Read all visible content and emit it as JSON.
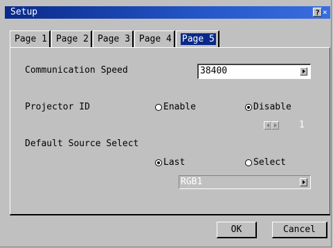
{
  "window": {
    "title": "Setup",
    "help_label": "?",
    "close_label": "×"
  },
  "tabs": [
    {
      "label": "Page 1"
    },
    {
      "label": "Page 2"
    },
    {
      "label": "Page 3"
    },
    {
      "label": "Page 4"
    },
    {
      "label": "Page 5",
      "active": true
    }
  ],
  "communication_speed": {
    "label": "Communication Speed",
    "value": "38400"
  },
  "projector_id": {
    "label": "Projector ID",
    "enable_label": "Enable",
    "disable_label": "Disable",
    "selected": "Disable",
    "id_value": "1"
  },
  "default_source": {
    "label": "Default Source Select",
    "last_label": "Last",
    "select_label": "Select",
    "selected": "Last",
    "source_value": "RGB1"
  },
  "footer": {
    "ok_label": "OK",
    "cancel_label": "Cancel"
  }
}
